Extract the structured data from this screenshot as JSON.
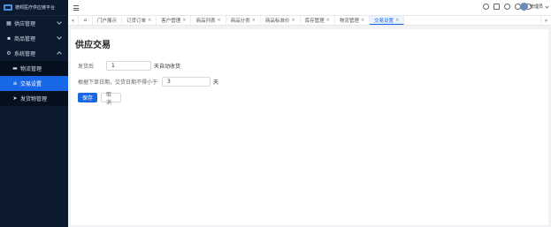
{
  "sidebar": {
    "logo_text": "德邦医疗供应链平台",
    "items": [
      {
        "label": "供应管理",
        "icon": "grid-icon",
        "expanded": false
      },
      {
        "label": "商品管理",
        "icon": "apps-icon",
        "expanded": false
      },
      {
        "label": "系统管理",
        "icon": "gear-icon",
        "expanded": true
      }
    ],
    "subitems": [
      {
        "label": "物流管理",
        "icon": "folder-icon",
        "active": false
      },
      {
        "label": "交易设置",
        "icon": "sliders-icon",
        "active": true
      },
      {
        "label": "发货物管理",
        "icon": "send-icon",
        "active": false
      }
    ]
  },
  "header": {
    "user_name": "管理员"
  },
  "tabs": {
    "left_arrow": "«",
    "right_arrow": "»",
    "home_icon": "⌂",
    "items": [
      {
        "label": "门户展示",
        "closable": false,
        "active": false
      },
      {
        "label": "订货订单",
        "closable": true,
        "active": false
      },
      {
        "label": "客户管理",
        "closable": true,
        "active": false
      },
      {
        "label": "商品列表",
        "closable": true,
        "active": false
      },
      {
        "label": "商品分类",
        "closable": true,
        "active": false
      },
      {
        "label": "商品标准价",
        "closable": true,
        "active": false
      },
      {
        "label": "库存管理",
        "closable": true,
        "active": false
      },
      {
        "label": "物流管理",
        "closable": true,
        "active": false
      },
      {
        "label": "交易设置",
        "closable": true,
        "active": true
      }
    ],
    "close_glyph": "×"
  },
  "page": {
    "title": "供应交易",
    "row1": {
      "prefix": "发货后",
      "value": "1",
      "suffix": "天自动收货"
    },
    "row2": {
      "prefix": "根据下单日期，交货日期不得小于",
      "value": "3",
      "suffix": "天"
    },
    "save_label": "保存",
    "cancel_label": "取消"
  },
  "colors": {
    "sidebar_bg": "#0b1a2f",
    "accent": "#1767e6"
  }
}
